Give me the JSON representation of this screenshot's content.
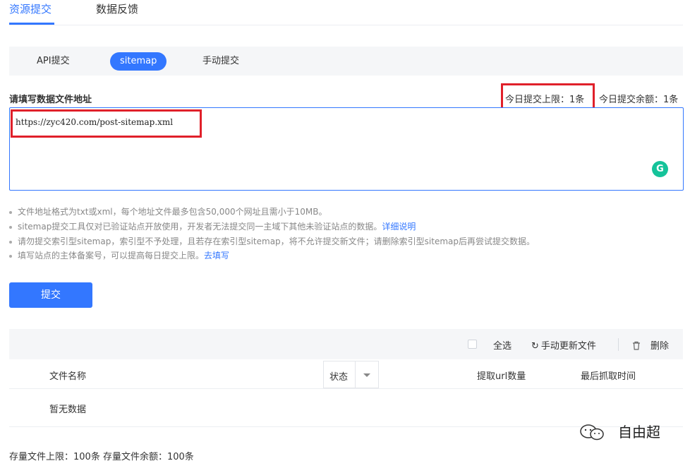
{
  "top_tabs": {
    "submit": "资源提交",
    "feedback": "数据反馈"
  },
  "sub_tabs": {
    "api": "API提交",
    "sitemap": "sitemap",
    "manual": "手动提交"
  },
  "form": {
    "label": "请填写数据文件地址",
    "daily_limit": "今日提交上限：1条",
    "daily_remaining": "今日提交余额：1条",
    "url_value": "https://zyc420.com/post-sitemap.xml"
  },
  "tips": [
    {
      "text": "文件地址格式为txt或xml，每个地址文件最多包含50,000个网址且需小于10MB。",
      "link": ""
    },
    {
      "text": "sitemap提交工具仅对已验证站点开放使用，开发者无法提交同一主域下其他未验证站点的数据。",
      "link": "详细说明"
    },
    {
      "text": "请勿提交索引型sitemap，索引型不予处理，且若存在索引型sitemap，将不允许提交新文件；请删除索引型sitemap后再尝试提交数据。",
      "link": ""
    },
    {
      "text": "填写站点的主体备案号，可以提高每日提交上限。",
      "link": "去填写"
    }
  ],
  "submit_button": "提交",
  "toolbar": {
    "select_all": "全选",
    "refresh": "手动更新文件",
    "delete": "删除"
  },
  "table": {
    "col_filename": "文件名称",
    "col_status": "状态",
    "col_url_count": "提取url数量",
    "col_last_crawl": "最后抓取时间",
    "empty": "暂无数据"
  },
  "storage": "存量文件上限：100条  存量文件余额：100条",
  "watermark": "自由超",
  "icons": {
    "grammarly": "grammarly-icon",
    "refresh": "refresh-icon",
    "trash": "trash-icon",
    "wechat": "wechat-icon"
  },
  "colors": {
    "accent": "#3377ff",
    "highlight_box": "#e0202a",
    "grammarly": "#15c39a"
  }
}
